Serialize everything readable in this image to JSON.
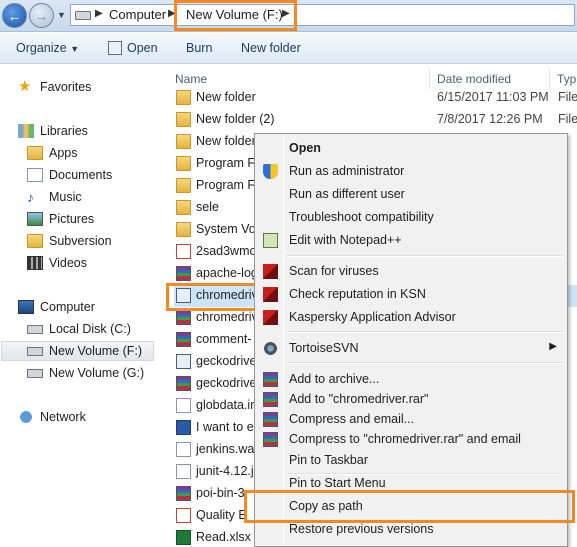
{
  "address_bar": {
    "crumbs": [
      "Computer",
      "New Volume (F:)"
    ]
  },
  "toolbar": {
    "organize": "Organize",
    "open": "Open",
    "burn": "Burn",
    "new_folder": "New folder"
  },
  "nav": {
    "favorites": "Favorites",
    "libraries": "Libraries",
    "apps": "Apps",
    "documents": "Documents",
    "music": "Music",
    "pictures": "Pictures",
    "subversion": "Subversion",
    "videos": "Videos",
    "computer": "Computer",
    "local_disk": "Local Disk (C:)",
    "new_volume_f": "New Volume (F:)",
    "new_volume_g": "New Volume (G:)",
    "network": "Network"
  },
  "columns": {
    "name": "Name",
    "date_modified": "Date modified",
    "type": "Typ"
  },
  "files": [
    {
      "name": "New folder",
      "date": "6/15/2017 11:03 PM",
      "type": "File",
      "icon": "folder-icon"
    },
    {
      "name": "New folder (2)",
      "date": "7/8/2017 12:26 PM",
      "type": "File",
      "icon": "folder-icon"
    },
    {
      "name": "New folder",
      "date": "",
      "type": "",
      "icon": "folder-icon"
    },
    {
      "name": "Program Fi",
      "date": "",
      "type": "",
      "icon": "folder-icon"
    },
    {
      "name": "Program Fi",
      "date": "",
      "type": "",
      "icon": "folder-icon"
    },
    {
      "name": "sele",
      "date": "",
      "type": "",
      "icon": "folder-icon"
    },
    {
      "name": "System Vol",
      "date": "",
      "type": "",
      "icon": "folder-icon"
    },
    {
      "name": "2sad3wmc",
      "date": "",
      "type": "",
      "icon": "pdf-icon"
    },
    {
      "name": "apache-log",
      "date": "",
      "type": "",
      "icon": "rar-icon"
    },
    {
      "name": "chromedriv",
      "date": "",
      "type": "",
      "icon": "exe-icon"
    },
    {
      "name": "chromedriv",
      "date": "",
      "type": "",
      "icon": "rar-icon"
    },
    {
      "name": "comment-",
      "date": "",
      "type": "",
      "icon": "rar-icon"
    },
    {
      "name": "geckodrive",
      "date": "",
      "type": "",
      "icon": "exe-icon"
    },
    {
      "name": "geckodrive",
      "date": "",
      "type": "",
      "icon": "rar-icon"
    },
    {
      "name": "globdata.in",
      "date": "",
      "type": "",
      "icon": "doc-icon"
    },
    {
      "name": "I want to e",
      "date": "",
      "type": "",
      "icon": "word-icon"
    },
    {
      "name": "jenkins.war",
      "date": "",
      "type": "",
      "icon": "doc-icon"
    },
    {
      "name": "junit-4.12.j",
      "date": "",
      "type": "",
      "icon": "doc-icon"
    },
    {
      "name": "poi-bin-3.",
      "date": "",
      "type": "",
      "icon": "rar-icon"
    },
    {
      "name": "Quality E",
      "date": "",
      "type": "",
      "icon": "pdf-icon"
    },
    {
      "name": "Read.xlsx",
      "date": "",
      "type": "",
      "icon": "xls-icon"
    }
  ],
  "context_menu": {
    "open": "Open",
    "run_as_admin": "Run as administrator",
    "run_as_different_user": "Run as different user",
    "troubleshoot": "Troubleshoot compatibility",
    "edit_notepad": "Edit with Notepad++",
    "scan_viruses": "Scan for viruses",
    "check_reputation": "Check reputation in KSN",
    "kaspersky_advisor": "Kaspersky Application Advisor",
    "tortoisesvn": "TortoiseSVN",
    "add_archive": "Add to archive...",
    "add_to_rar": "Add to \"chromedriver.rar\"",
    "compress_email": "Compress and email...",
    "compress_rar_email": "Compress to \"chromedriver.rar\" and email",
    "pin_taskbar": "Pin to Taskbar",
    "pin_start": "Pin to Start Menu",
    "copy_path": "Copy as path",
    "restore_versions": "Restore previous versions"
  },
  "colors": {
    "highlight": "#f08a24",
    "selection": "#cce4f7"
  }
}
